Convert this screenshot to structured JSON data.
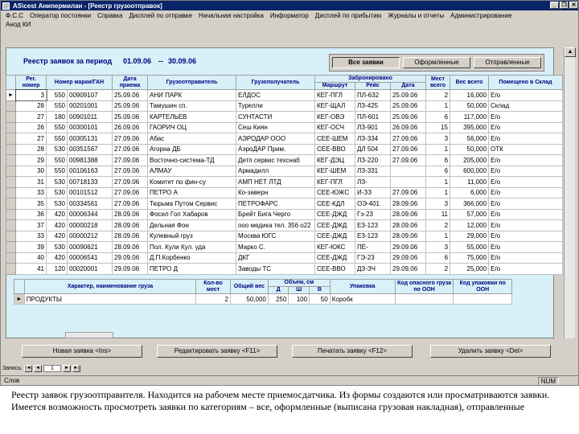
{
  "window": {
    "title": "AS\\cest Анипермилан - [Реестр грузоотправок]",
    "minimize": "_",
    "restore": "❐",
    "close": "✕"
  },
  "menu": [
    "Ф.С.С",
    "Оператор постоянки",
    "Справка",
    "Дисплей по отправке",
    "Начальная настройка",
    "Информатор",
    "Дисплей по прибытию",
    "Журналы и отчеты",
    "Администрирование"
  ],
  "subbar": "Анод КИ",
  "register": {
    "title": "Реестр заявок за период",
    "date_from": "01.09.06",
    "dash": "--",
    "date_to": "30.09.06"
  },
  "filters": {
    "all": "Все заявки",
    "processed": "Оформленные",
    "sent": "Отправленные"
  },
  "columns": {
    "reg_num": "Рег. номер",
    "mark": "Номер марки/ГАН",
    "date": "Дата приема",
    "shipper": "Грузоотправитель",
    "consignee": "Грузополучатель",
    "reserved": "Забронировано",
    "route": "Маршрут",
    "flight": "Рейс",
    "rdate": "Дата",
    "places": "Мест всего",
    "weight": "Вес всего",
    "storage": "Помещено в Склад"
  },
  "rows": [
    {
      "reg": "3",
      "mark": "550",
      "num": "00909107",
      "date": "25.09.06",
      "shipper": "АНИ ПАРК",
      "consignee": "ЕЛДОС",
      "route": "КЕГ-ПГЛ",
      "flight": "ПЛ-632",
      "rdate": "25.09.06",
      "places": "2",
      "weight": "16,000",
      "storage": "Е/о"
    },
    {
      "reg": "28",
      "mark": "550",
      "num": "00201001",
      "date": "25.09.06",
      "shipper": "Тамушин сп.",
      "consignee": "Турелли",
      "route": "КЕГ-ЩАЛ",
      "flight": "ЛЗ-425",
      "rdate": "25.09.06",
      "places": "1",
      "weight": "50,000",
      "storage": "Склад"
    },
    {
      "reg": "27",
      "mark": "180",
      "num": "00901011",
      "date": "25.09.06",
      "shipper": "КАРТЕЛЬЕВ",
      "consignee": "СУНТАСТИ",
      "route": "КЕГ-ОВЭ",
      "flight": "ПЛ-601",
      "rdate": "25.09.06",
      "places": "6",
      "weight": "117,000",
      "storage": "Е/о"
    },
    {
      "reg": "26",
      "mark": "550",
      "num": "00300101",
      "date": "26.09.06",
      "shipper": "ГАОРИЧ ОЦ",
      "consignee": "Сеш Киян",
      "route": "КЕГ-ОСЧ",
      "flight": "ЛЗ-901",
      "rdate": "26.09.06",
      "places": "15",
      "weight": "395,000",
      "storage": "Е/о"
    },
    {
      "reg": "27",
      "mark": "550",
      "num": "00305131",
      "date": "27.09.06",
      "shipper": "Абас",
      "consignee": "АЭРОДАР ООО",
      "route": "СЕЕ-ШЕМ",
      "flight": "ЛЗ-334",
      "rdate": "27.09.06",
      "places": "3",
      "weight": "56,000",
      "storage": "Е/о"
    },
    {
      "reg": "28",
      "mark": "530",
      "num": "00351567",
      "date": "27.09.06",
      "shipper": "Агорна ДБ",
      "consignee": "АэроДАР Прим.",
      "route": "СЕЕ-ВВО",
      "flight": "ДЛ 504",
      "rdate": "27.09.06",
      "places": "1",
      "weight": "50,000",
      "storage": "ОТК"
    },
    {
      "reg": "29",
      "mark": "550",
      "num": "00981388",
      "date": "27.09.06",
      "shipper": "Восточно-система-ТД",
      "consignee": "Детп сервис техснаб",
      "route": "КЕГ-ДЭЦ",
      "flight": "ЛЗ-220",
      "rdate": "27.09.06",
      "places": "6",
      "weight": "205,000",
      "storage": "Е/о"
    },
    {
      "reg": "30",
      "mark": "550",
      "num": "00106163",
      "date": "27.09.06",
      "shipper": "АЛМАУ",
      "consignee": "Армадилл",
      "route": "КЕГ-ШЕМ",
      "flight": "ЛЗ-331",
      "rdate": "",
      "places": "6",
      "weight": "600,000",
      "storage": "Е/о"
    },
    {
      "reg": "31",
      "mark": "530",
      "num": "00718133",
      "date": "27.09.06",
      "shipper": "Комитет по фин-су",
      "consignee": "АМП НЕТ ЛТД",
      "route": "КЕГ-ПГЛ",
      "flight": "ЛЗ-",
      "rdate": "",
      "places": "1",
      "weight": "11,000",
      "storage": "Е/о"
    },
    {
      "reg": "33",
      "mark": "530",
      "num": "00101512",
      "date": "27.09.06",
      "shipper": "ПЕТРО А",
      "consignee": "Ко-заверн",
      "route": "СЕЕ-ЮЖС",
      "flight": "И-ЗЗ",
      "rdate": "27.09.06",
      "places": "1",
      "weight": "6,000",
      "storage": "Е/о"
    },
    {
      "reg": "35",
      "mark": "530",
      "num": "00334561",
      "date": "27.09.06",
      "shipper": "Тюрьма Путом Сервис",
      "consignee": "ПЕТРОФАРС",
      "route": "СЕЕ-КДЛ",
      "flight": "ОЭ-401",
      "rdate": "28.09.06",
      "places": "3",
      "weight": "366,000",
      "storage": "Е/о"
    },
    {
      "reg": "36",
      "mark": "420",
      "num": "00006344",
      "date": "28.09.06",
      "shipper": "Фосил Гол Хабаров",
      "consignee": "Брейт Бига Черго",
      "route": "СЕЕ-ДЖД",
      "flight": "Гэ-23",
      "rdate": "28.09.06",
      "places": "11",
      "weight": "57,000",
      "storage": "Е/о"
    },
    {
      "reg": "37",
      "mark": "420",
      "num": "00000218",
      "date": "28.09.06",
      "shipper": "Дельная Фон",
      "consignee": "ооо медика тел. 356 о22",
      "route": "СЕЕ-ДЖД",
      "flight": "ЕЗ-123",
      "rdate": "28.09.06",
      "places": "2",
      "weight": "12,000",
      "storage": "Е/о"
    },
    {
      "reg": "33",
      "mark": "420",
      "num": "00000212",
      "date": "28.09.06",
      "shipper": "Кулевный груз",
      "consignee": "Москва ЮГС",
      "route": "СЕЕ-ДЖД",
      "flight": "ЕЗ-123",
      "rdate": "28.09.06",
      "places": "1",
      "weight": "29,000",
      "storage": "Е/о"
    },
    {
      "reg": "39",
      "mark": "530",
      "num": "00090621",
      "date": "28.09.06",
      "shipper": "Пол. Кули Кул. уда",
      "consignee": "Марко С.",
      "route": "КЕГ-ЮКС",
      "flight": "ПЕ-",
      "rdate": "29.09.06",
      "places": "3",
      "weight": "55,000",
      "storage": "Е/о"
    },
    {
      "reg": "40",
      "mark": "420",
      "num": "00006541",
      "date": "29.09.06",
      "shipper": "Д.П.Корбенко",
      "consignee": "ДКГ",
      "route": "СЕЕ-ДЖД",
      "flight": "ГЭ-23",
      "rdate": "29.09.06",
      "places": "6",
      "weight": "75,000",
      "storage": "Е/о"
    },
    {
      "reg": "41",
      "mark": "120",
      "num": "00020001",
      "date": "29.09.06",
      "shipper": "ПЕТРО Д",
      "consignee": "Заводы ТС",
      "route": "СЕЕ-ВВО",
      "flight": "ДЗ-ЗЧ",
      "rdate": "29.09.06",
      "places": "2",
      "weight": "25,000",
      "storage": "Е/о"
    }
  ],
  "detail_columns": {
    "name": "Характер, наименование груза",
    "places": "Кол-во мест",
    "weight": "Общий вес",
    "volume": "Объем, см",
    "d": "Д",
    "w": "Ш",
    "h": "В",
    "pack": "Упаковка",
    "hazard": "Код опасного груза по ООН",
    "packcode": "Код упаковки по ООН"
  },
  "detail_rows": [
    {
      "name": "ПРОДУКТЫ",
      "places": "2",
      "weight": "50,000",
      "d": "250",
      "w": "100",
      "h": "50",
      "pack": "Коробк",
      "hazard": "",
      "packcode": ""
    }
  ],
  "actions": {
    "new": "Новая заявка <Ins>",
    "edit": "Редактировать заявку <F11>",
    "print": "Печатать заявку <F12>",
    "delete": "Удалить заявку <Del>"
  },
  "navigator": {
    "label": "Запись:",
    "current": "1"
  },
  "status": {
    "left": "Слов",
    "numlock": "NUM"
  },
  "caption": "Реестр заявок грузоотправителя. Находится на рабочем месте приемосдатчика. Из формы создаются или просматриваются заявки. Имеется возможность просмотреть заявки по категориям – все, оформленные (выписана грузовая накладная), отправленные",
  "colors": {
    "titlebar": "#0a246a",
    "panel": "#d8f0f8",
    "header_text": "#000080",
    "chrome": "#d4d0c8"
  }
}
